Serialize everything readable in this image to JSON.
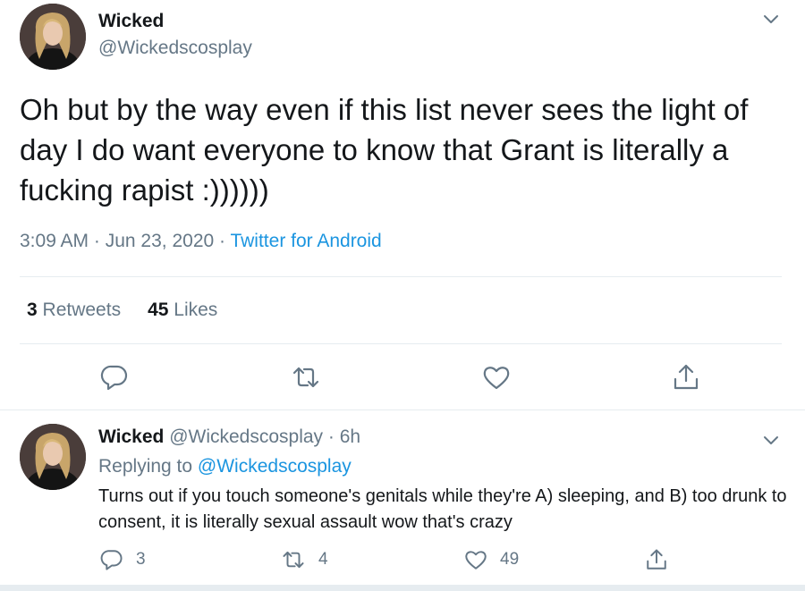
{
  "main_tweet": {
    "display_name": "Wicked",
    "handle": "@Wickedscosplay",
    "text": "Oh but by the way even if this list never sees the light of day I do want everyone to know that Grant is literally a fucking rapist :))))))",
    "time": "3:09 AM",
    "date": "Jun 23, 2020",
    "source": "Twitter for Android",
    "separator": " · ",
    "retweets_count": "3",
    "retweets_label": "Retweets",
    "likes_count": "45",
    "likes_label": "Likes"
  },
  "reply_tweet": {
    "display_name": "Wicked",
    "handle": "@Wickedscosplay",
    "age": "6h",
    "separator": " · ",
    "replying_label": "Replying to",
    "replying_to": "@Wickedscosplay",
    "text": "Turns out if you touch someone's genitals while they're A) sleeping, and B) too drunk to consent, it is literally sexual assault wow that's crazy",
    "reply_count": "3",
    "retweet_count": "4",
    "like_count": "49"
  },
  "colors": {
    "accent": "#1b95e0",
    "secondary_text": "#657786",
    "primary_text": "#14171a",
    "divider": "#e6ecf0"
  },
  "icons": [
    "avatar",
    "chevron-down-icon",
    "reply-icon",
    "retweet-icon",
    "like-icon",
    "share-icon"
  ]
}
